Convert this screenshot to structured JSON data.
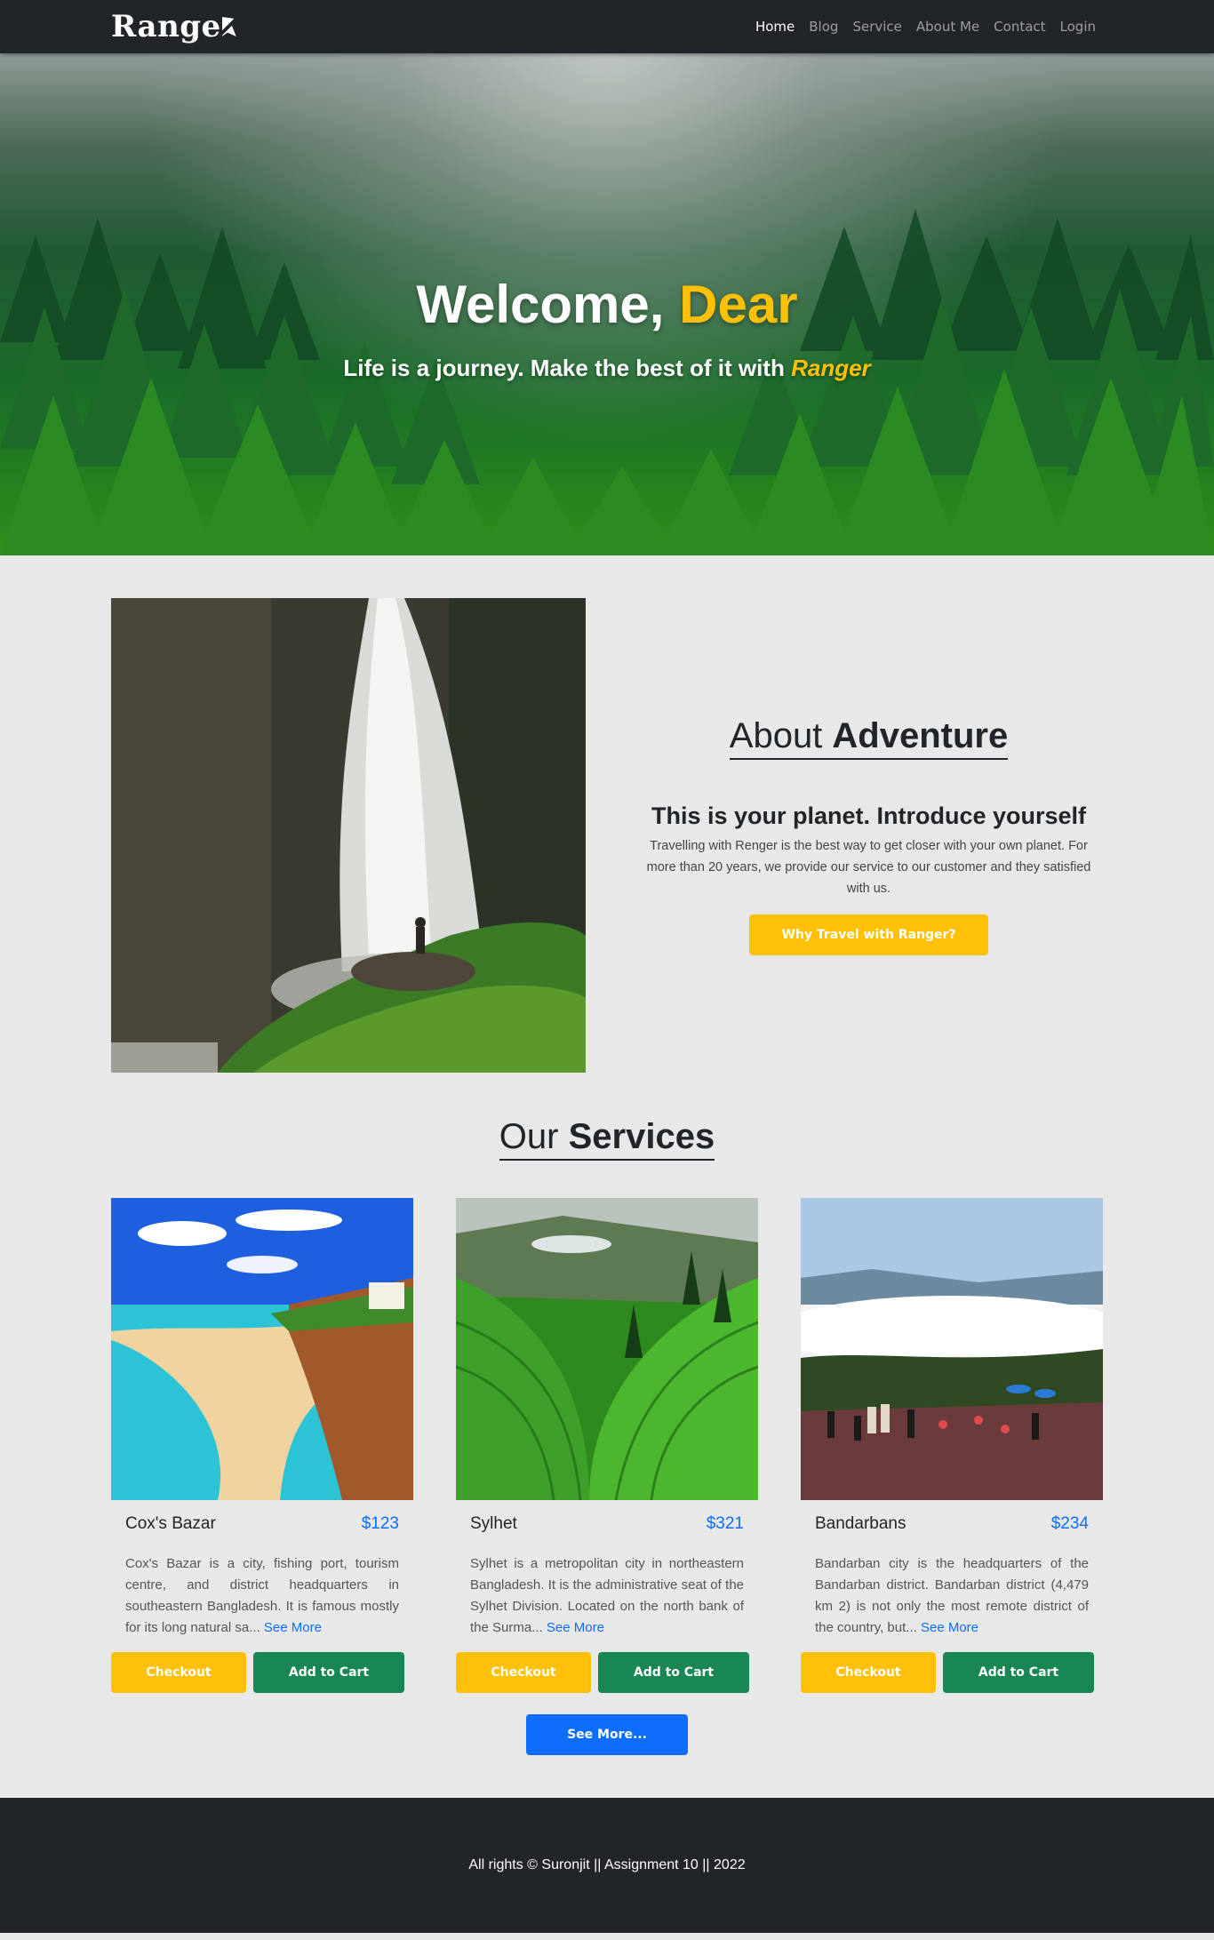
{
  "navbar": {
    "logo": "Range",
    "links": [
      "Home",
      "Blog",
      "Service",
      "About Me",
      "Contact",
      "Login"
    ],
    "active": "Home"
  },
  "hero": {
    "title_main": "Welcome,",
    "title_accent": "Dear",
    "subtitle": "Life is a journey. Make the best of it with",
    "subtitle_brand": "Ranger"
  },
  "about": {
    "heading_light": "About",
    "heading_bold": "Adventure",
    "subheading": "This is your planet. Introduce yourself",
    "description": "Travelling with Renger is the best way to get closer with your own planet. For more than 20 years, we provide our service to our customer and they satisfied with us.",
    "button": "Why Travel with Ranger?"
  },
  "services": {
    "heading_light": "Our",
    "heading_bold": "Services",
    "cards": [
      {
        "name": "Cox's Bazar",
        "price": "$123",
        "description": "Cox's Bazar is a city, fishing port, tourism centre, and district headquarters in southeastern Bangladesh. It is famous mostly for its long natural sa...",
        "see_more": "See More",
        "checkout": "Checkout",
        "cart": "Add to Cart"
      },
      {
        "name": "Sylhet",
        "price": "$321",
        "description": "Sylhet is a metropolitan city in northeastern Bangladesh. It is the administrative seat of the Sylhet Division. Located on the north bank of the Surma...",
        "see_more": "See More",
        "checkout": "Checkout",
        "cart": "Add to Cart"
      },
      {
        "name": "Bandarbans",
        "price": "$234",
        "description": "Bandarban city is the headquarters of the Bandarban district. Bandarban district (4,479 km 2) is not only the most remote district of the country, but...",
        "see_more": "See More",
        "checkout": "Checkout",
        "cart": "Add to Cart"
      }
    ],
    "see_more_button": "See More..."
  },
  "footer": {
    "text": "All rights © Suronjit || Assignment 10 || 2022"
  },
  "colors": {
    "accent": "#ffc107",
    "primary": "#0d6efd",
    "success": "#198754",
    "dark": "#212529"
  }
}
